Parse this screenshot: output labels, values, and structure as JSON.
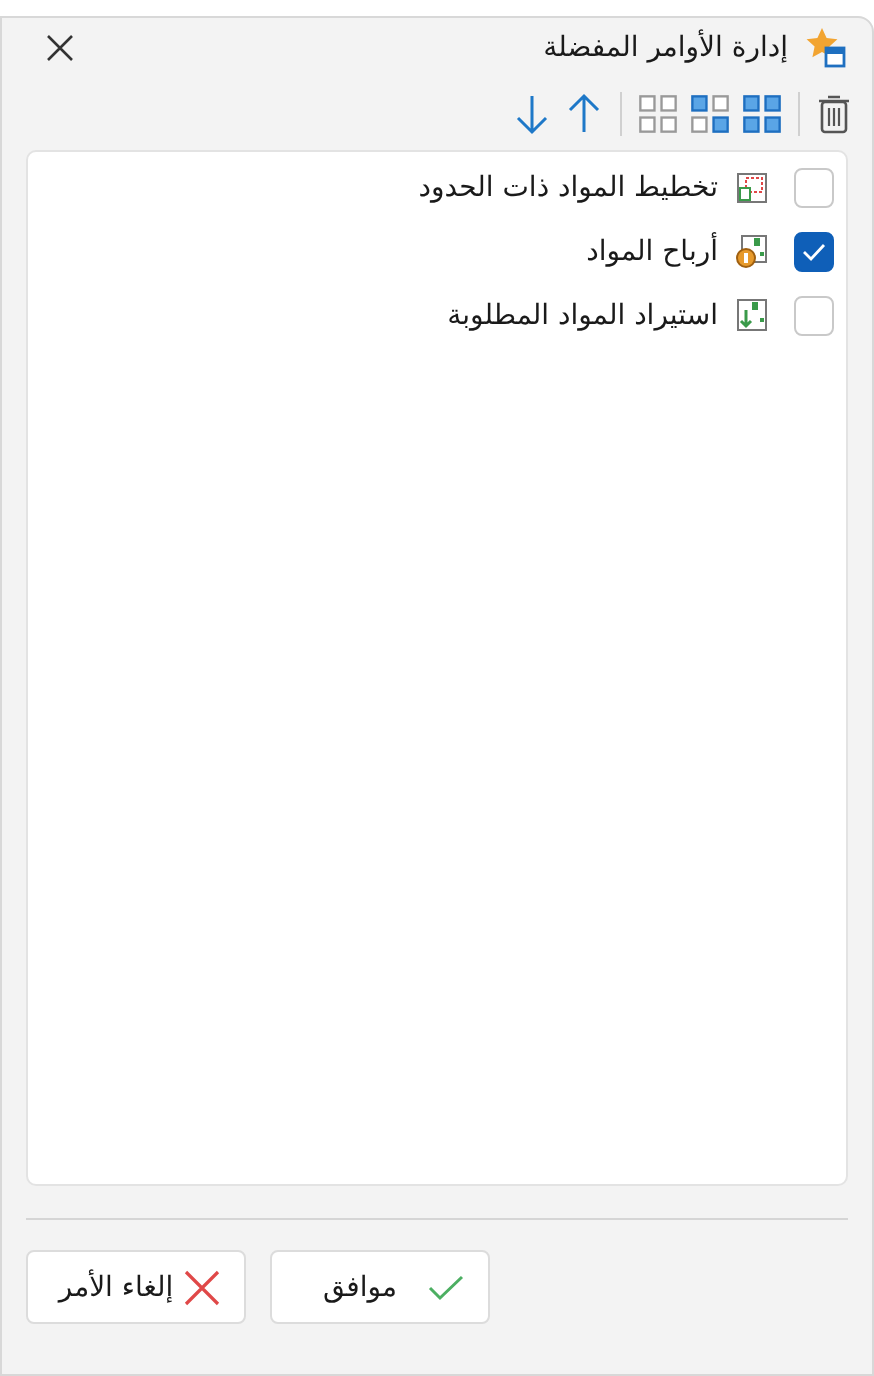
{
  "window": {
    "title": "إدارة الأوامر المفضلة"
  },
  "items": [
    {
      "label": "تخطيط المواد ذات الحدود",
      "checked": false,
      "kind": "plan"
    },
    {
      "label": "أرباح المواد",
      "checked": true,
      "kind": "profit"
    },
    {
      "label": "استيراد المواد المطلوبة",
      "checked": false,
      "kind": "import"
    }
  ],
  "buttons": [
    {
      "label": "موافق",
      "kind": "ok"
    },
    {
      "label": "إلغاء الأمر",
      "kind": "cancel"
    }
  ]
}
